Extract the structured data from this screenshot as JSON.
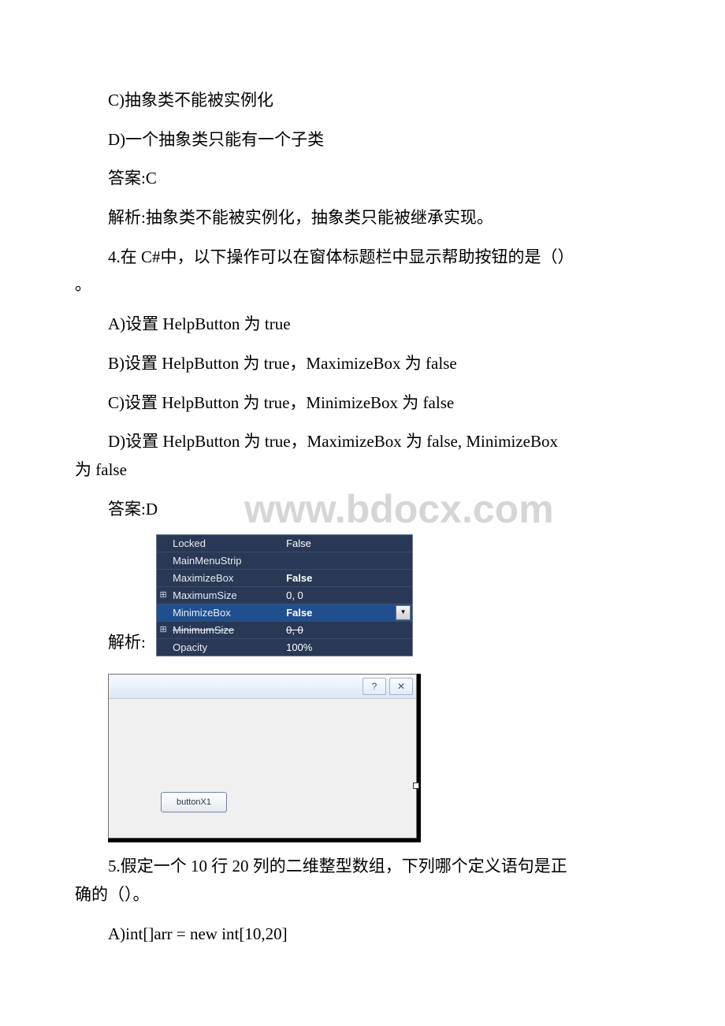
{
  "watermark": "www.bdocx.com",
  "lines": {
    "c": "C)抽象类不能被实例化",
    "d": "D)一个抽象类只能有一个子类",
    "ans1": "答案:C",
    "exp1": "解析:抽象类不能被实例化，抽象类只能被继承实现。",
    "q4a": "4.在 C#中，以下操作可以在窗体标题栏中显示帮助按钮的是（）",
    "q4b": "。",
    "q4A": "A)设置 HelpButton 为 true",
    "q4B": "B)设置 HelpButton 为 true，MaximizeBox 为 false",
    "q4C": "C)设置 HelpButton 为 true，MinimizeBox 为 false",
    "q4D1": "D)设置 HelpButton 为 true，MaximizeBox 为 false, MinimizeBox",
    "q4D2": "为 false",
    "ans4": "答案:D",
    "jiexi": "解析:",
    "q5a": "5.假定一个 10 行 20 列的二维整型数组，下列哪个定义语句是正",
    "q5b": "确的（）。",
    "q5A": "A)int[]arr = new int[10,20]"
  },
  "props": [
    {
      "exp": "",
      "name": "Locked",
      "val": "False",
      "boldv": false,
      "sel": false
    },
    {
      "exp": "",
      "name": "MainMenuStrip",
      "val": "",
      "boldv": false,
      "sel": false
    },
    {
      "exp": "",
      "name": "MaximizeBox",
      "val": "False",
      "boldv": true,
      "sel": false
    },
    {
      "exp": "⊞",
      "name": "MaximumSize",
      "val": "0, 0",
      "boldv": false,
      "sel": false
    },
    {
      "exp": "",
      "name": "MinimizeBox",
      "val": "False",
      "boldv": true,
      "sel": true
    },
    {
      "exp": "⊞",
      "name": "MinimumSize",
      "val": "0, 0",
      "boldv": false,
      "strike": true,
      "sel": false
    },
    {
      "exp": "",
      "name": "Opacity",
      "val": "100%",
      "boldv": false,
      "sel": false
    }
  ],
  "form": {
    "help": "?",
    "close": "✕",
    "button": "buttonX1"
  }
}
